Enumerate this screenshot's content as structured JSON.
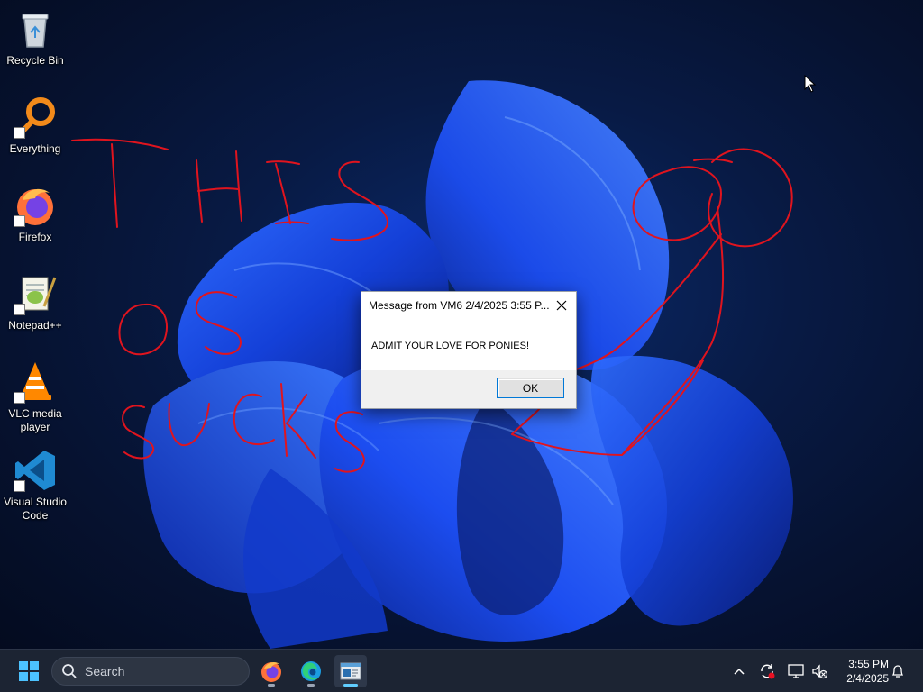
{
  "desktop": {
    "icons": [
      {
        "label": "Recycle Bin",
        "icon": "recycle-bin-icon"
      },
      {
        "label": "Everything",
        "icon": "everything-search-icon"
      },
      {
        "label": "Firefox",
        "icon": "firefox-icon"
      },
      {
        "label": "Notepad++",
        "icon": "notepad-plus-plus-icon"
      },
      {
        "label": "VLC media player",
        "icon": "vlc-icon"
      },
      {
        "label": "Visual Studio Code",
        "icon": "vscode-icon"
      }
    ]
  },
  "dialog": {
    "title": "Message from VM6 2/4/2025 3:55 P...",
    "message": "ADMIT YOUR LOVE FOR PONIES!",
    "ok_label": "OK"
  },
  "taskbar": {
    "search_placeholder": "Search",
    "pinned": [
      "firefox-icon",
      "edge-icon",
      "message-app-icon"
    ],
    "clock": {
      "time": "3:55 PM",
      "date": "2/4/2025"
    }
  },
  "colors": {
    "scribble": "#e0141e",
    "taskbar": "#1c2433",
    "accent": "#0078d7"
  }
}
